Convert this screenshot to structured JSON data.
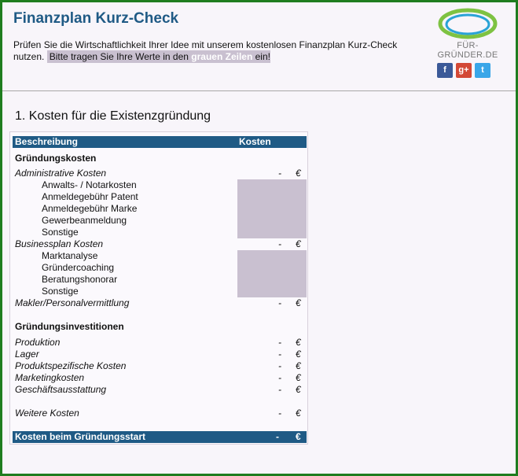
{
  "header": {
    "title": "Finanzplan Kurz-Check",
    "intro_text": "Prüfen Sie die Wirtschaftlichkeit Ihrer Idee mit unserem  kostenlosen Finanzplan Kurz-Check nutzen.",
    "highlight_pre": "Bitte tragen Sie Ihre Werte in den ",
    "highlight_bold": "grauen Zeilen",
    "highlight_post": " ein!",
    "logo_text": "FÜR-GRÜNDER.DE",
    "social": {
      "facebook": "f",
      "googleplus": "g+",
      "twitter": "t"
    }
  },
  "section": {
    "title": "1. Kosten für die Existenzgründung"
  },
  "table": {
    "columns": {
      "description": "Beschreibung",
      "cost": "Kosten"
    },
    "group1_title": "Gründungskosten",
    "admin": {
      "label": "Administrative Kosten",
      "value": "-",
      "currency": "€",
      "items": [
        "Anwalts- / Notarkosten",
        "Anmeldegebühr Patent",
        "Anmeldegebühr Marke",
        "Gewerbeanmeldung",
        "Sonstige"
      ]
    },
    "bplan": {
      "label": "Businessplan Kosten",
      "value": "-",
      "currency": "€",
      "items": [
        "Marktanalyse",
        "Gründercoaching",
        "Beratungshonorar",
        "Sonstige"
      ]
    },
    "makler": {
      "label": "Makler/Personalvermittlung",
      "value": "-",
      "currency": "€"
    },
    "group2_title": "Gründungsinvestitionen",
    "invest": [
      {
        "label": "Produktion",
        "value": "-",
        "currency": "€"
      },
      {
        "label": "Lager",
        "value": "-",
        "currency": "€"
      },
      {
        "label": "Produktspezifische Kosten",
        "value": "-",
        "currency": "€"
      },
      {
        "label": "Marketingkosten",
        "value": "-",
        "currency": "€"
      },
      {
        "label": "Geschäftsausstattung",
        "value": "-",
        "currency": "€"
      }
    ],
    "weitere": {
      "label": "Weitere Kosten",
      "value": "-",
      "currency": "€"
    },
    "total": {
      "label": "Kosten beim Gründungsstart",
      "value": "-",
      "currency": "€"
    }
  },
  "colors": {
    "frame": "#1f7d1f",
    "title": "#1f5a85",
    "header_bar": "#1f5a85",
    "input_gray": "#c9c0d0"
  }
}
